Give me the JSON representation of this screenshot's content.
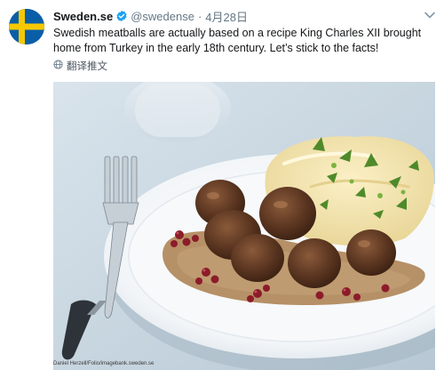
{
  "tweet": {
    "display_name": "Sweden.se",
    "handle": "@swedense",
    "separator": "·",
    "date": "4月28日",
    "text": "Swedish meatballs are actually based on a recipe King Charles XII brought home from Turkey in the early 18th century. Let’s stick to the facts!",
    "translate_label": "翻译推文",
    "photo_credit": "Daniel Herzell/Folio/imagebank.sweden.se"
  },
  "icons": {
    "avatar": "swedish-flag",
    "verified": "verified-badge-icon",
    "translate": "globe-icon",
    "more": "chevron-down-icon"
  },
  "colors": {
    "verified_blue": "#1da1f2",
    "flag_blue": "#0a5ea8",
    "flag_yellow": "#f7c800",
    "secondary_text": "#657786"
  }
}
